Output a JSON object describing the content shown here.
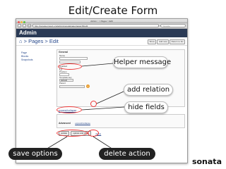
{
  "slide": {
    "title": "Edit/Create Form",
    "logo": "sonata"
  },
  "browser": {
    "window_title": "Admin :: > Pages > Edit",
    "url": "http://sonata.project.org/admin/sonata/page/page/15/edit",
    "search_placeholder": "Google"
  },
  "admin": {
    "brand": "Admin",
    "breadcrumb": "⌂ > Pages > Edit",
    "actions": [
      "Show",
      "Add new",
      "Return to list"
    ]
  },
  "sidebar": {
    "items": [
      "Page",
      "Blocks",
      "Snapshots"
    ]
  },
  "form": {
    "legend_general": "General",
    "label_name": "Name",
    "label_enabled": "Enabled",
    "label_position": "Position",
    "label_template": "Template key",
    "template_value": "default",
    "label_parent": "Parent",
    "add_relation_symbol": "+",
    "expand_link_text": "expand/collapse",
    "legend_advanced": "Advanced",
    "advanced_link_text": "expand/collapse",
    "save_button": "update",
    "save_and_list_button": "update and close",
    "delete_link": "delete"
  },
  "callouts": {
    "helper": "Helper message",
    "add_relation": "add relation",
    "hide_fields": "hide fields",
    "save_options": "save options",
    "delete_action": "delete action"
  },
  "colors": {
    "admin_bar": "#2a3a55",
    "annotation_ring": "#e33333",
    "link": "#2a4b8d"
  }
}
